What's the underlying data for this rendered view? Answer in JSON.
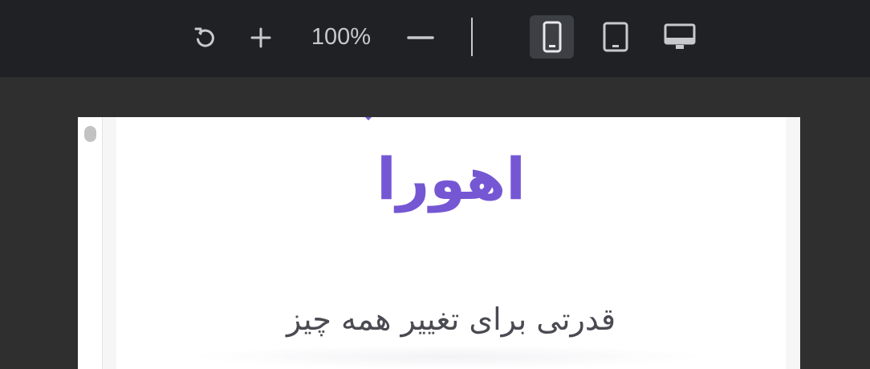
{
  "toolbar": {
    "zoom_label": "100%",
    "reset_icon": "rotate-ccw-icon",
    "zoom_in_icon": "plus-icon",
    "zoom_out_icon": "minus-icon",
    "devices": [
      {
        "name": "mobile",
        "icon": "phone-icon",
        "active": true
      },
      {
        "name": "tablet",
        "icon": "tablet-icon",
        "active": false
      },
      {
        "name": "desktop",
        "icon": "monitor-icon",
        "active": false
      }
    ],
    "colors": {
      "bar_bg": "#202124",
      "icon": "#c8c9cc",
      "active_bg": "#3c3f44"
    }
  },
  "preview": {
    "brand_name": "اهورا",
    "tagline": "قدرتی برای تغییر همه چیز",
    "colors": {
      "brand": "#7557d4",
      "tagline": "#4a4a52",
      "canvas_bg": "#2f2f30"
    }
  }
}
